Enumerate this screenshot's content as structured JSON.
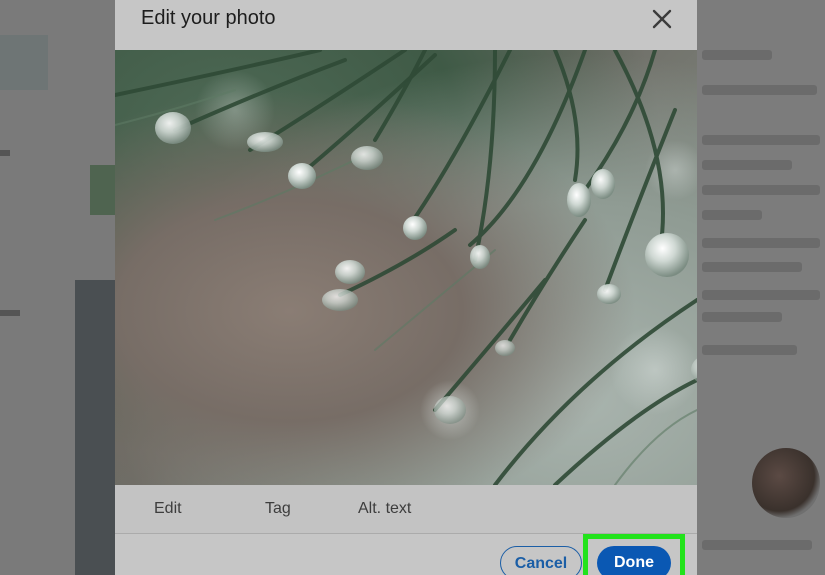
{
  "modal": {
    "title": "Edit your photo",
    "close_icon": "close-icon",
    "tabs": [
      {
        "label": "Edit"
      },
      {
        "label": "Tag"
      },
      {
        "label": "Alt. text"
      }
    ],
    "buttons": {
      "cancel": "Cancel",
      "done": "Done"
    }
  },
  "colors": {
    "primary": "#0a58b3",
    "highlight": "#22e31b",
    "modal_bg": "#c6c6c6"
  }
}
